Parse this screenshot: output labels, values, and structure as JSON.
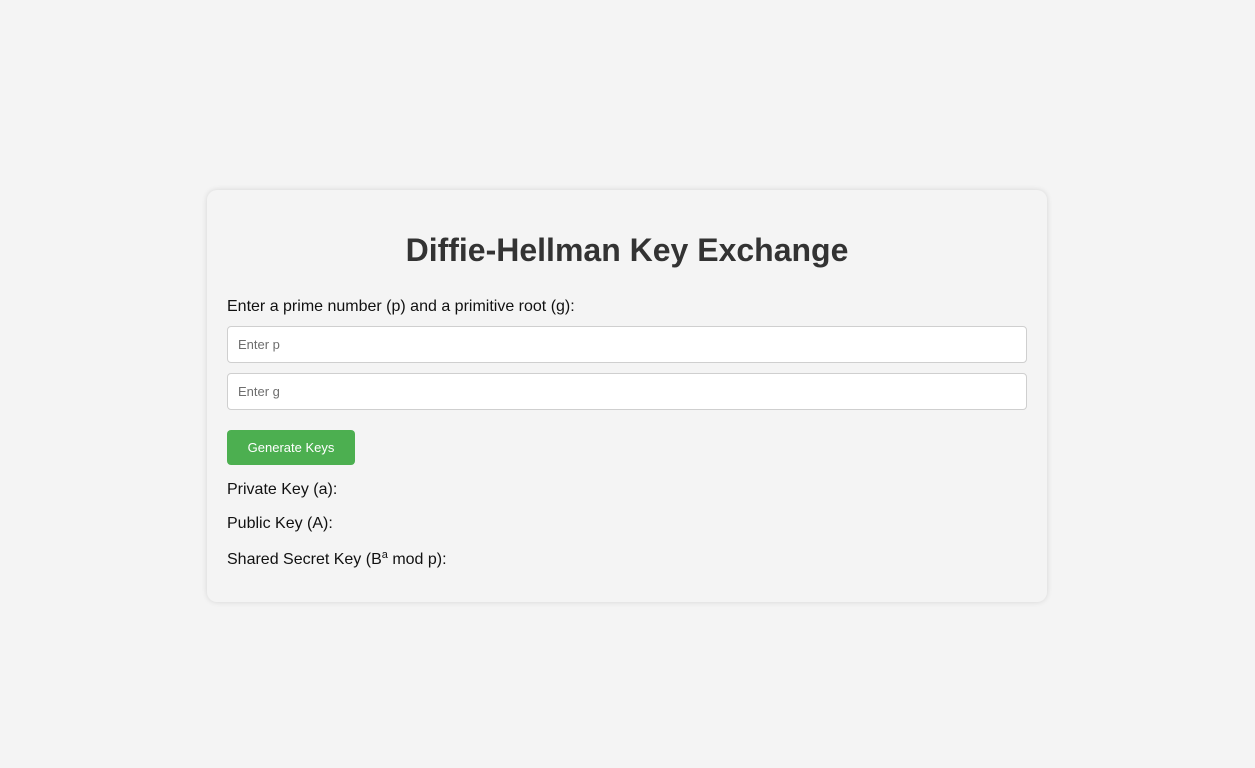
{
  "title": "Diffie-Hellman Key Exchange",
  "prompt": "Enter a prime number (p) and a primitive root (g):",
  "inputs": {
    "p": {
      "value": "",
      "placeholder": "Enter p"
    },
    "g": {
      "value": "",
      "placeholder": "Enter g"
    }
  },
  "generate_button": {
    "label": "Generate Keys",
    "color": "#4caf50"
  },
  "results": {
    "private_key_label": "Private Key (a):",
    "public_key_label": "Public Key (A):",
    "shared_secret_prefix": "Shared Secret Key (B",
    "shared_secret_exponent": "a",
    "shared_secret_suffix": " mod p):"
  },
  "colors": {
    "background": "#f4f4f4",
    "title": "#333333",
    "button": "#4caf50"
  }
}
